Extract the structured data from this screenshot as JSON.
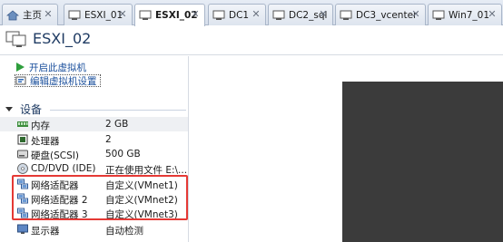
{
  "tabs": [
    {
      "label": "主页",
      "icon": "home-icon",
      "active": false
    },
    {
      "label": "ESXI_01",
      "icon": "vm-icon",
      "active": false
    },
    {
      "label": "ESXI_02",
      "icon": "vm-icon",
      "active": true
    },
    {
      "label": "DC1",
      "icon": "vm-icon",
      "active": false
    },
    {
      "label": "DC2_sql",
      "icon": "vm-icon",
      "active": false
    },
    {
      "label": "DC3_vcenter",
      "icon": "vm-icon",
      "active": false
    },
    {
      "label": "Win7_01",
      "icon": "vm-icon",
      "active": false
    }
  ],
  "header": {
    "title": "ESXI_02"
  },
  "commands": {
    "power_on": "开启此虚拟机",
    "edit_settings": "编辑虚拟机设置"
  },
  "devices_section": {
    "title": "设备"
  },
  "devices": [
    {
      "name": "内存",
      "value": "2 GB",
      "icon": "memory-icon"
    },
    {
      "name": "处理器",
      "value": "2",
      "icon": "cpu-icon"
    },
    {
      "name": "硬盘(SCSI)",
      "value": "500 GB",
      "icon": "disk-icon"
    },
    {
      "name": "CD/DVD (IDE)",
      "value": "正在使用文件 E:\\...",
      "icon": "cd-icon"
    },
    {
      "name": "网络适配器",
      "value": "自定义(VMnet1)",
      "icon": "network-icon"
    },
    {
      "name": "网络适配器 2",
      "value": "自定义(VMnet2)",
      "icon": "network-icon"
    },
    {
      "name": "网络适配器 3",
      "value": "自定义(VMnet3)",
      "icon": "network-icon"
    },
    {
      "name": "显示器",
      "value": "自动检测",
      "icon": "monitor-icon"
    }
  ],
  "colors": {
    "highlight_box": "#e53935",
    "console_bg": "#3b3b3b",
    "link": "#1a4f9c"
  }
}
